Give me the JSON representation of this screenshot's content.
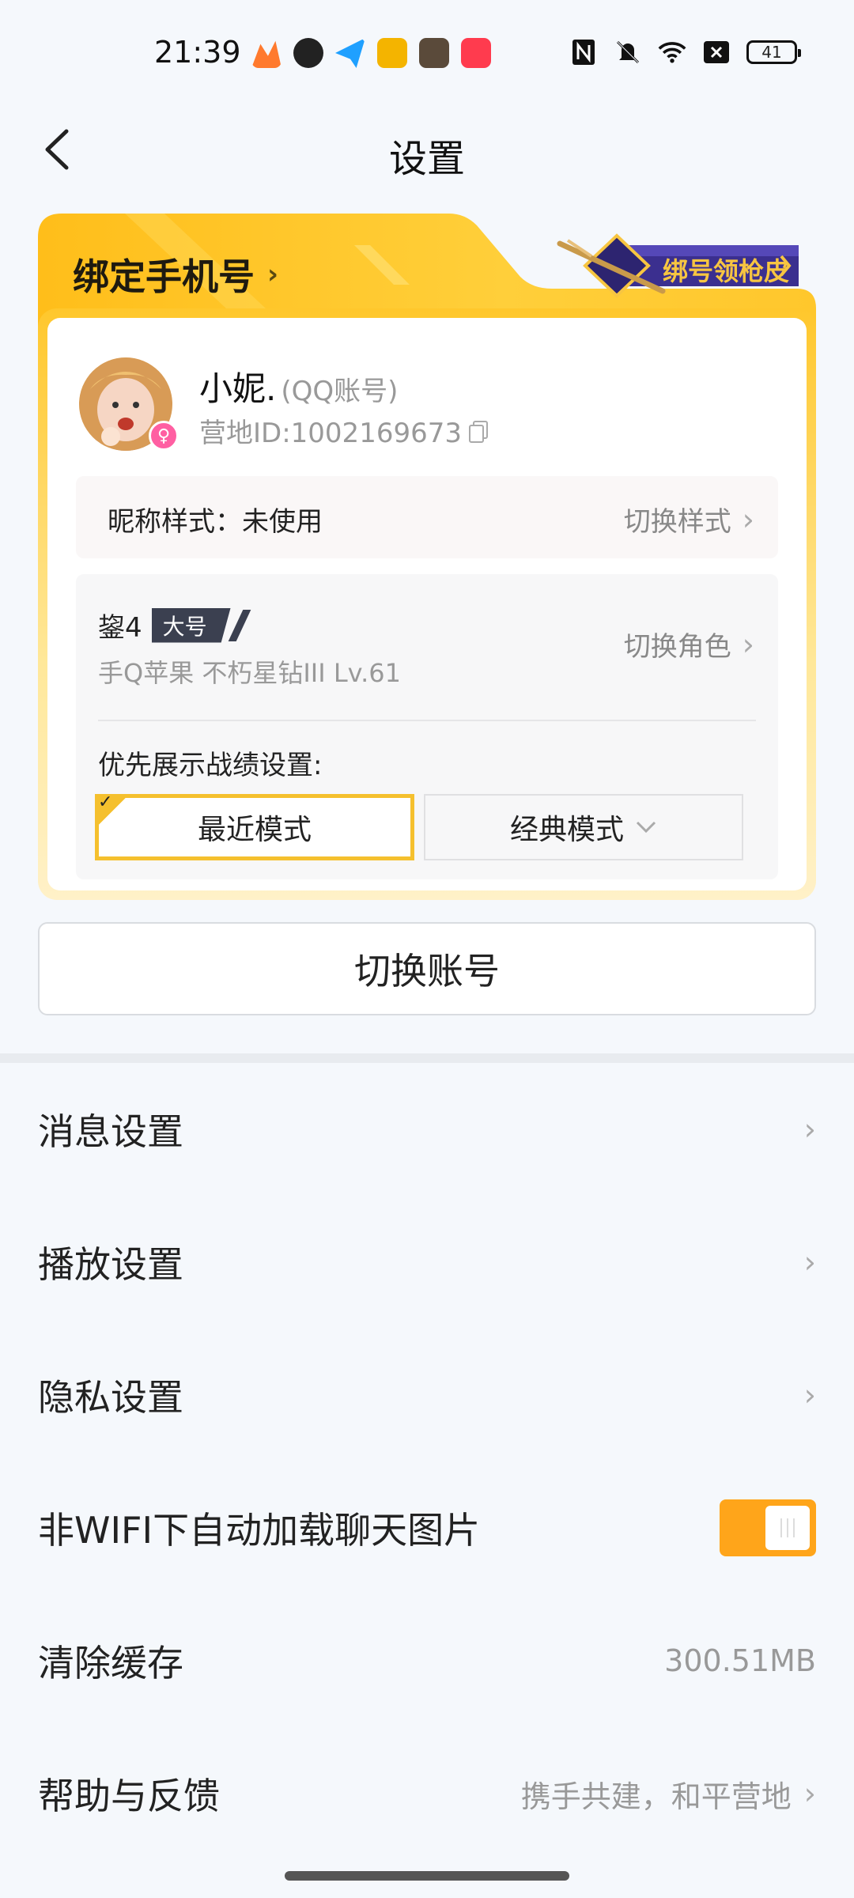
{
  "status_bar": {
    "time": "21:39",
    "battery": "41",
    "app_icons": [
      {
        "name": "app-icon-1",
        "color": "#ff7a2e"
      },
      {
        "name": "app-icon-2",
        "color": "#222222"
      },
      {
        "name": "app-icon-3",
        "color": "#1fa0ff"
      },
      {
        "name": "app-icon-4",
        "color": "#f4b400"
      },
      {
        "name": "app-icon-5",
        "color": "#5a4a3a"
      },
      {
        "name": "app-icon-6",
        "color": "#ff3b4e"
      }
    ],
    "system_icons": [
      "nfc-icon",
      "mute-icon",
      "wifi-icon",
      "signal-off-icon"
    ]
  },
  "header": {
    "title": "设置"
  },
  "bind_card": {
    "title": "绑定手机号",
    "promo_label": "绑号领枪皮"
  },
  "profile": {
    "name": "小妮.",
    "account_type": "(QQ账号)",
    "id_label": "营地ID:1002169673",
    "gender": "female"
  },
  "nickname_style": {
    "label": "昵称样式：未使用",
    "action": "切换样式"
  },
  "role": {
    "name": "鋆4",
    "tag": "大号",
    "details": "手Q苹果  不朽星钻III  Lv.61",
    "action": "切换角色"
  },
  "record_pref": {
    "label": "优先展示战绩设置:",
    "mode_recent": "最近模式",
    "mode_classic": "经典模式"
  },
  "switch_account_label": "切换账号",
  "settings": [
    {
      "label": "消息设置",
      "value": "",
      "type": "link"
    },
    {
      "label": "播放设置",
      "value": "",
      "type": "link"
    },
    {
      "label": "隐私设置",
      "value": "",
      "type": "link"
    },
    {
      "label": "非WIFI下自动加载聊天图片",
      "value": "",
      "type": "toggle",
      "on": true
    },
    {
      "label": "清除缓存",
      "value": "300.51MB",
      "type": "value"
    },
    {
      "label": "帮助与反馈",
      "value": "携手共建，和平营地",
      "type": "link"
    }
  ],
  "colors": {
    "accent": "#ffa51a",
    "card_gold": "#ffc72c",
    "selected_border": "#f5c02e"
  }
}
